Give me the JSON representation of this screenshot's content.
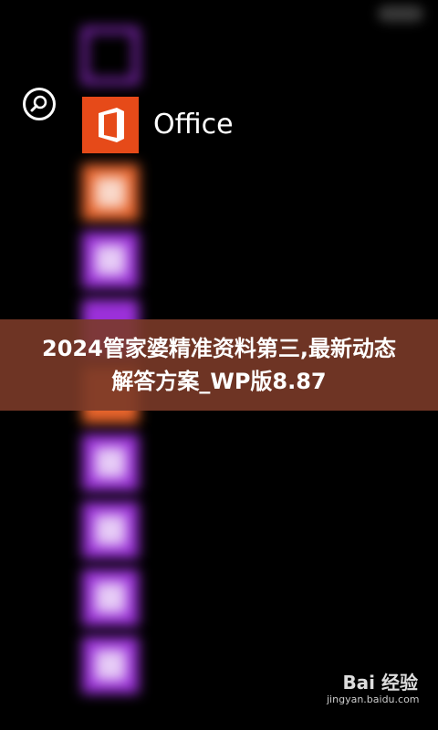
{
  "colors": {
    "background": "#000000",
    "office_tile": "#e64a19",
    "purple_tile": "#9b30d9",
    "orange_tile": "#e8642c",
    "banner_bg": "#7a3a28"
  },
  "search": {
    "icon": "search-icon"
  },
  "apps": {
    "items": [
      {
        "label": "",
        "icon": "app-tile-icon"
      },
      {
        "label": "Office",
        "icon": "office-icon"
      },
      {
        "label": "",
        "icon": "office-lens-icon"
      },
      {
        "label": "",
        "icon": "onenote-icon"
      },
      {
        "label": "",
        "icon": "app-tile-icon"
      },
      {
        "label": "",
        "icon": "outlook-icon"
      },
      {
        "label": "",
        "icon": "people-icon"
      },
      {
        "label": "",
        "icon": "phone-icon"
      },
      {
        "label": "",
        "icon": "photo-icon"
      },
      {
        "label": "",
        "icon": "photos-icon"
      }
    ]
  },
  "banner": {
    "title": "2024管家婆精准资料第三,最新动态解答方案_WP版8.87"
  },
  "watermark": {
    "brand": "Bai 经验",
    "url": "jingyan.baidu.com"
  }
}
